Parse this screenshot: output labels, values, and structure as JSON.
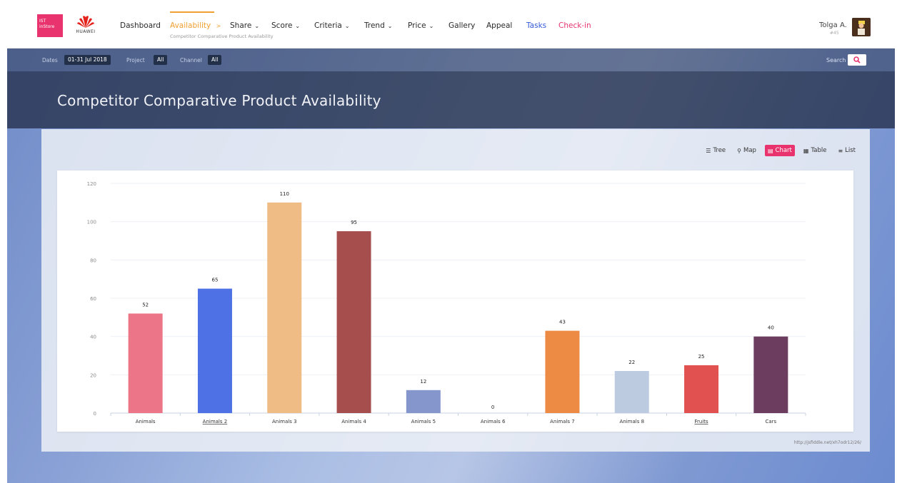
{
  "brand": {
    "box_text": "IST inStore",
    "logo_text": "HUAWEI"
  },
  "nav": {
    "items": [
      {
        "label": "Dashboard",
        "chevron": false
      },
      {
        "label": "Availability",
        "chevron": true,
        "active": true
      },
      {
        "label": "Share",
        "chevron": true
      },
      {
        "label": "Score",
        "chevron": true
      },
      {
        "label": "Criteria",
        "chevron": true
      },
      {
        "label": "Trend",
        "chevron": true
      },
      {
        "label": "Price",
        "chevron": true
      },
      {
        "label": "Gallery",
        "chevron": false
      },
      {
        "label": "Appeal",
        "chevron": false
      },
      {
        "label": "Tasks",
        "chevron": false
      },
      {
        "label": "Check-in",
        "chevron": false
      }
    ],
    "active_sub": "Competitor Comparative Product Availability",
    "active_arrow": ">",
    "dropdown_chevron": "⌄"
  },
  "user": {
    "name": "Tolga A.",
    "sub": "#45"
  },
  "filters": {
    "dates_label": "Dates",
    "dates_value": "01-31 Jul 2018",
    "project_label": "Project",
    "project_value": "All",
    "channel_label": "Channel",
    "channel_value": "All",
    "search_label": "Search"
  },
  "page": {
    "title": "Competitor Comparative Product Availability"
  },
  "view_tabs": [
    {
      "label": "Tree",
      "icon": "tree-icon",
      "glyph": "☰"
    },
    {
      "label": "Map",
      "icon": "map-pin-icon",
      "glyph": "⚲"
    },
    {
      "label": "Chart",
      "icon": "chart-icon",
      "glyph": "▤",
      "active": true
    },
    {
      "label": "Table",
      "icon": "table-icon",
      "glyph": "▦"
    },
    {
      "label": "List",
      "icon": "list-icon",
      "glyph": "≡"
    }
  ],
  "footnote": "http://jsfiddle.net/xh7odr12/26/",
  "colors": {
    "accent": "#e8336e",
    "nav_active": "#f0a030",
    "tasks": "#3559d9"
  },
  "chart_data": {
    "type": "bar",
    "categories": [
      "Animals",
      "Animals 2",
      "Animals 3",
      "Animals 4",
      "Animals 5",
      "Animals 6",
      "Animals 7",
      "Animals 8",
      "Fruits",
      "Cars"
    ],
    "underlined": [
      false,
      true,
      false,
      false,
      false,
      false,
      false,
      false,
      true,
      false
    ],
    "values": [
      52,
      65,
      110,
      95,
      12,
      0,
      43,
      22,
      25,
      40
    ],
    "colors": [
      "#ec7688",
      "#4e71e5",
      "#efbc85",
      "#a54e4d",
      "#8596cc",
      "#c9c9c9",
      "#ed8a44",
      "#bccbe0",
      "#e0514f",
      "#6d3d5f"
    ],
    "yticks": [
      0,
      20,
      40,
      60,
      80,
      100,
      120
    ],
    "ylim": [
      0,
      120
    ],
    "grid": true,
    "title": "",
    "xlabel": "",
    "ylabel": ""
  }
}
